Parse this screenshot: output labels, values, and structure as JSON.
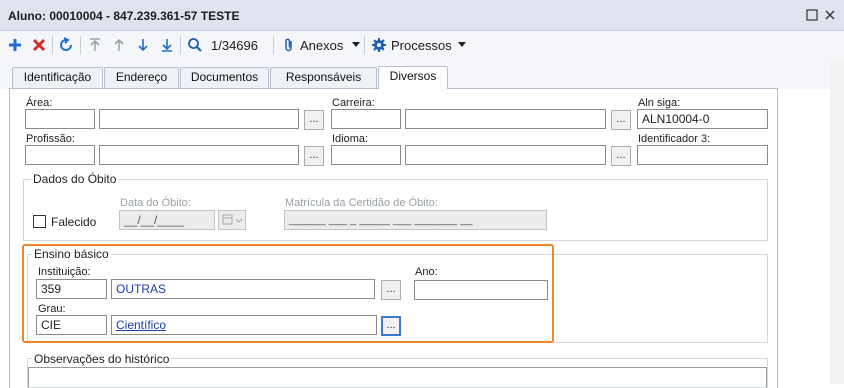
{
  "window": {
    "title": "Aluno: 00010004 - 847.239.361-57 TESTE",
    "restore_icon": "restore-icon",
    "close_icon": "close-icon"
  },
  "toolbar": {
    "record_counter": "1/34696",
    "anexos_label": "Anexos",
    "processos_label": "Processos",
    "icons": [
      "add-icon",
      "delete-icon",
      "refresh-icon",
      "first-record-icon",
      "previous-record-icon",
      "next-record-icon",
      "last-record-icon",
      "search-icon",
      "paperclip-icon",
      "gear-icon"
    ]
  },
  "tabs": [
    {
      "label": "Identificação",
      "active": false
    },
    {
      "label": "Endereço",
      "active": false
    },
    {
      "label": "Documentos",
      "active": false
    },
    {
      "label": "Responsáveis",
      "active": false
    },
    {
      "label": "Diversos",
      "active": true
    }
  ],
  "fields": {
    "area_label": "Área:",
    "area_code": "",
    "area_desc": "",
    "carreira_label": "Carreira:",
    "carreira_code": "",
    "carreira_desc": "",
    "aln_siga_label": "Aln siga:",
    "aln_siga_value": "ALN10004-0",
    "profissao_label": "Profissão:",
    "profissao_code": "",
    "profissao_desc": "",
    "idioma_label": "Idioma:",
    "idioma_code": "",
    "idioma_desc": "",
    "identificador3_label": "Identificador 3:",
    "identificador3_value": "",
    "lookup_label": "..."
  },
  "obito": {
    "group_title": "Dados do Óbito",
    "falecido_label": "Falecido",
    "falecido_checked": false,
    "data_label": "Data do Óbito:",
    "data_value": "__/__/____",
    "matricula_label": "Matrícula da Certidão de Óbito:",
    "matricula_value": "______ ___ _ _____ ___ _______ __"
  },
  "ensino": {
    "group_title": "Ensino básico",
    "instituicao_label": "Instituição:",
    "instituicao_code": "359",
    "instituicao_desc": "OUTRAS",
    "ano_label": "Ano:",
    "ano_value": "",
    "grau_label": "Grau:",
    "grau_code": "CIE",
    "grau_desc": "Científico"
  },
  "observacoes": {
    "group_title": "Observações do histórico"
  },
  "colors": {
    "highlight": "#f0862c",
    "link": "#1b3fa8",
    "add": "#1f6fd1",
    "delete": "#d22b2b"
  }
}
